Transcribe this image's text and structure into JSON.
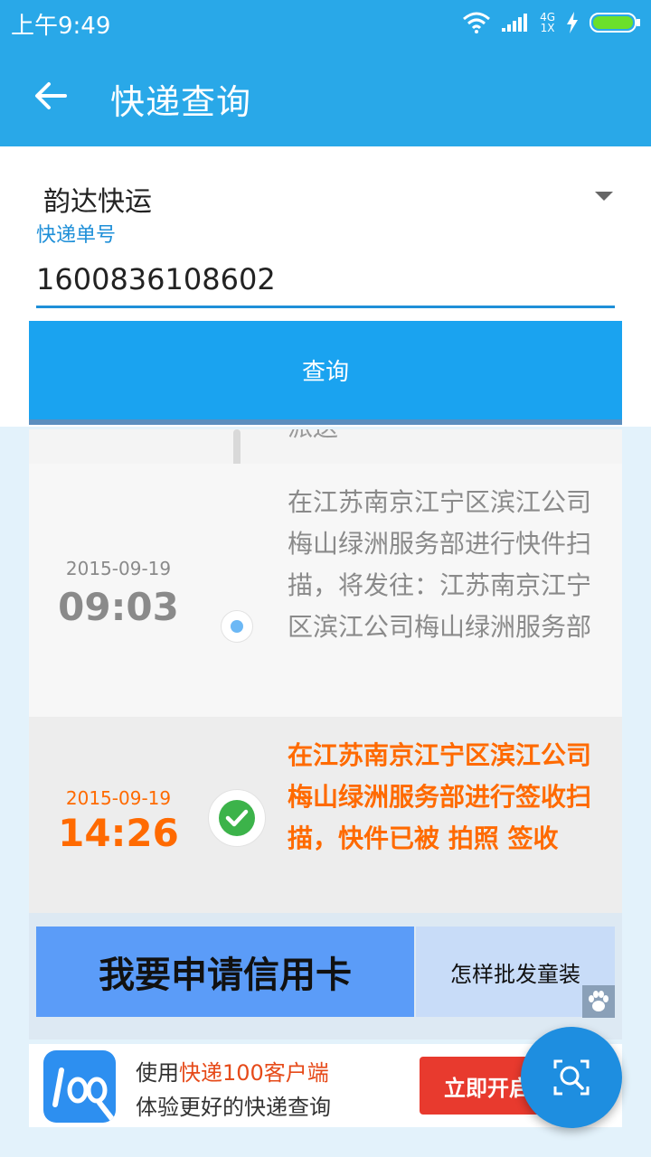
{
  "status_bar": {
    "time": "上午9:49",
    "network_top": "4G",
    "network_bottom": "1X"
  },
  "app_bar": {
    "title": "快递查询"
  },
  "form": {
    "company": "韵达快运",
    "number_label": "快递单号",
    "tracking_number": "1600836108602",
    "query_button": "查询"
  },
  "timeline": {
    "partial_text": "派送",
    "events": [
      {
        "date": "2015-09-19",
        "time": "09:03",
        "description": "在江苏南京江宁区滨江公司梅山绿洲服务部进行快件扫描，将发往：江苏南京江宁区滨江公司梅山绿洲服务部",
        "status": "in-transit"
      },
      {
        "date": "2015-09-19",
        "time": "14:26",
        "description": "在江苏南京江宁区滨江公司梅山绿洲服务部进行签收扫描，快件已被 拍照 签收",
        "status": "delivered"
      }
    ]
  },
  "ads": {
    "left": "我要申请信用卡",
    "right": "怎样批发童装"
  },
  "promo": {
    "line1_prefix": "使用",
    "line1_highlight": "快递100客户端",
    "line2": "体验更好的快递查询",
    "button": "立即开启"
  },
  "colors": {
    "primary": "#29a8e8",
    "accent_orange": "#ff6a00",
    "button_blue": "#1aa3f0",
    "promo_red": "#e83a2e"
  },
  "icons": [
    "back-arrow-icon",
    "wifi-icon",
    "signal-icon",
    "charging-icon",
    "battery-icon",
    "dropdown-icon",
    "check-icon",
    "paw-icon",
    "app-logo-icon",
    "search-scan-icon"
  ]
}
